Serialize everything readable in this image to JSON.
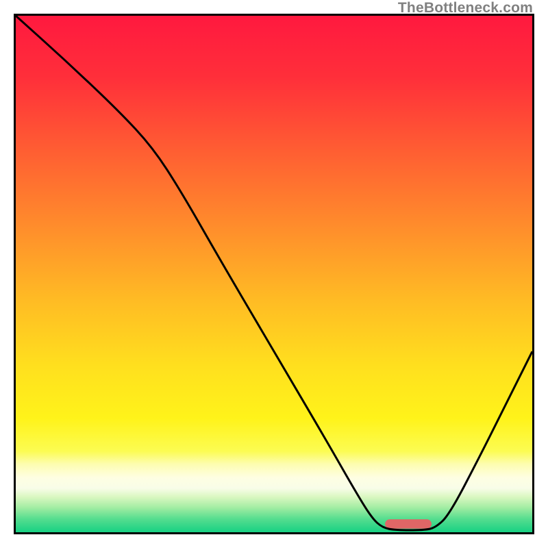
{
  "watermark": "TheBottleneck.com",
  "colors": {
    "gradient_stops": [
      {
        "offset": 0.0,
        "color": "#ff193f"
      },
      {
        "offset": 0.12,
        "color": "#ff2f3a"
      },
      {
        "offset": 0.25,
        "color": "#ff5a33"
      },
      {
        "offset": 0.4,
        "color": "#ff8a2c"
      },
      {
        "offset": 0.55,
        "color": "#ffbb24"
      },
      {
        "offset": 0.68,
        "color": "#ffe01e"
      },
      {
        "offset": 0.78,
        "color": "#fff31a"
      },
      {
        "offset": 0.843,
        "color": "#fcfc52"
      },
      {
        "offset": 0.868,
        "color": "#fdfdb0"
      },
      {
        "offset": 0.894,
        "color": "#fefee2"
      },
      {
        "offset": 0.915,
        "color": "#f8fde8"
      },
      {
        "offset": 0.932,
        "color": "#d9f7c0"
      },
      {
        "offset": 0.952,
        "color": "#a3eda3"
      },
      {
        "offset": 0.974,
        "color": "#56dd8f"
      },
      {
        "offset": 1.0,
        "color": "#17d183"
      }
    ],
    "curve": "#000000",
    "marker": "#e06666",
    "frame": "#000000"
  },
  "chart_data": {
    "type": "line",
    "title": "",
    "xlabel": "",
    "ylabel": "",
    "xlim": [
      0,
      100
    ],
    "ylim": [
      0,
      100
    ],
    "grid": false,
    "legend": false,
    "curve_points": [
      {
        "x": 0.0,
        "y": 100.0
      },
      {
        "x": 10.0,
        "y": 91.0
      },
      {
        "x": 20.0,
        "y": 81.5
      },
      {
        "x": 26.5,
        "y": 74.5
      },
      {
        "x": 32.0,
        "y": 66.0
      },
      {
        "x": 40.0,
        "y": 52.0
      },
      {
        "x": 50.0,
        "y": 35.0
      },
      {
        "x": 60.0,
        "y": 18.0
      },
      {
        "x": 66.0,
        "y": 7.5
      },
      {
        "x": 69.0,
        "y": 2.7
      },
      {
        "x": 71.0,
        "y": 0.9
      },
      {
        "x": 73.5,
        "y": 0.4
      },
      {
        "x": 79.0,
        "y": 0.4
      },
      {
        "x": 81.3,
        "y": 0.9
      },
      {
        "x": 84.0,
        "y": 3.5
      },
      {
        "x": 90.0,
        "y": 15.0
      },
      {
        "x": 95.0,
        "y": 25.0
      },
      {
        "x": 100.0,
        "y": 35.0
      }
    ],
    "marker": {
      "x_center": 76.0,
      "y": 1.6,
      "width": 9.0,
      "height": 1.8
    }
  }
}
